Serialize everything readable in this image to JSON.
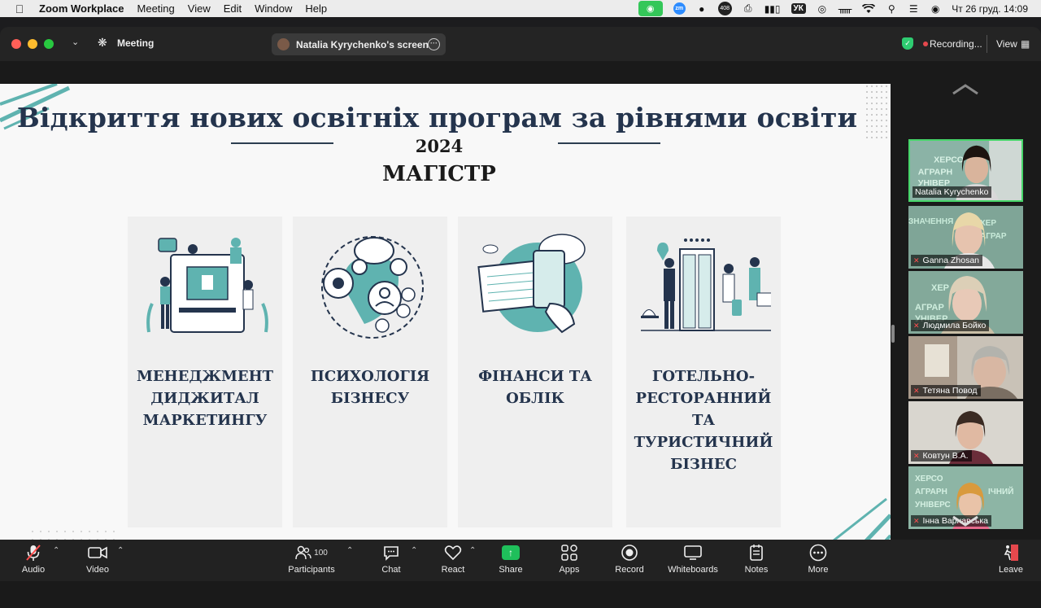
{
  "menubar": {
    "app_name": "Zoom Workplace",
    "items": [
      "Meeting",
      "View",
      "Edit",
      "Window",
      "Help"
    ],
    "badge_count": "408",
    "language": "УК",
    "clock": "Чт 26 груд.  14:09"
  },
  "titlebar": {
    "meeting_label": "Meeting",
    "screen_share_label": "Natalia Kyrychenko's screen",
    "recording_label": "Recording...",
    "view_label": "View"
  },
  "slide": {
    "title": "Відкриття нових освітніх програм за рівнями освіти",
    "year": "2024",
    "level": "МАГІСТР",
    "cards": [
      {
        "title": "МЕНЕДЖМЕНТ ДИДЖИТАЛ МАРКЕТИНГУ"
      },
      {
        "title": "ПСИХОЛОГІЯ БІЗНЕСУ"
      },
      {
        "title": "ФІНАНСИ ТА ОБЛІК"
      },
      {
        "title": "ГОТЕЛЬНО-РЕСТОРАННИЙ ТА ТУРИСТИЧНИЙ БІЗНЕС"
      }
    ]
  },
  "participants_strip": [
    {
      "name": "Natalia Kyrychenko",
      "muted": false
    },
    {
      "name": "Ganna Zhosan",
      "muted": true
    },
    {
      "name": "Людмила Бойко",
      "muted": true
    },
    {
      "name": "Тетяна Повод",
      "muted": true
    },
    {
      "name": "Ковтун В.А.",
      "muted": true
    },
    {
      "name": "Інна Варнавська",
      "muted": true
    }
  ],
  "toolbar": {
    "audio": "Audio",
    "video": "Video",
    "participants": "Participants",
    "participants_count": "100",
    "chat": "Chat",
    "react": "React",
    "share": "Share",
    "apps": "Apps",
    "record": "Record",
    "whiteboards": "Whiteboards",
    "notes": "Notes",
    "more": "More",
    "leave": "Leave"
  },
  "colors": {
    "accent_teal": "#5fb3b0",
    "slide_title": "#24344d",
    "active_speaker": "#47d66a",
    "share_green": "#1fbf5b",
    "leave_red": "#e5484d"
  }
}
